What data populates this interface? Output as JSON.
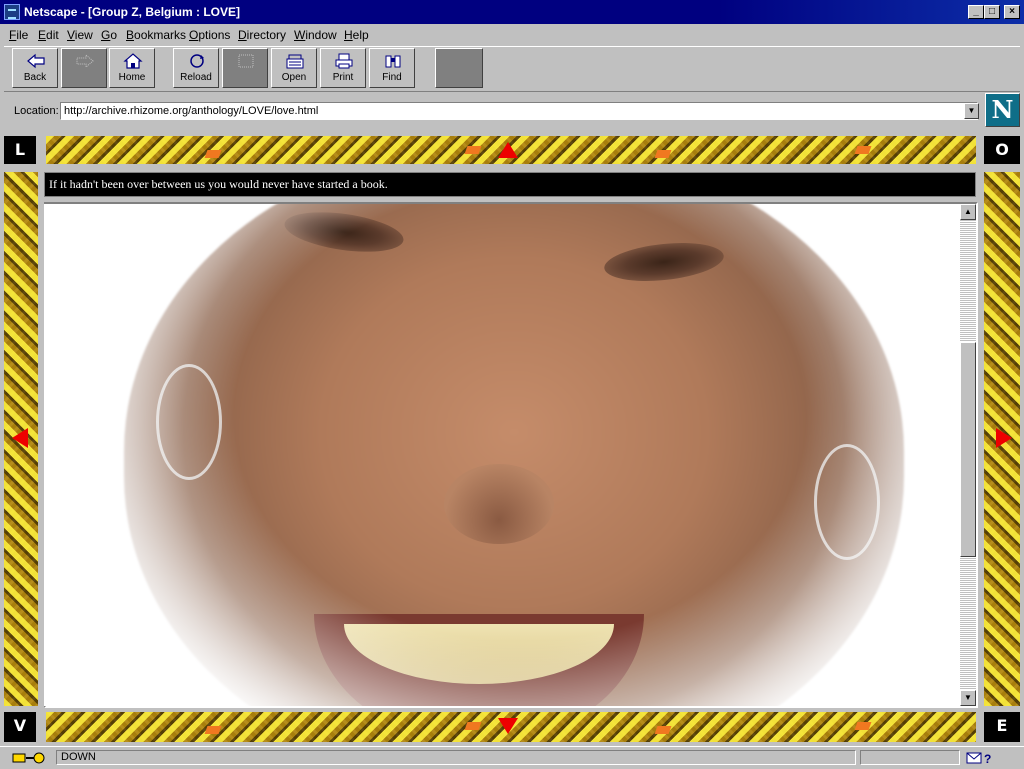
{
  "window": {
    "title": "Netscape - [Group Z, Belgium : LOVE]",
    "minimize": "_",
    "maximize": "□",
    "close": "×"
  },
  "menu": [
    "File",
    "Edit",
    "View",
    "Go",
    "Bookmarks",
    "Options",
    "Directory",
    "Window",
    "Help"
  ],
  "toolbar": {
    "back": "Back",
    "home": "Home",
    "reload": "Reload",
    "open": "Open",
    "print": "Print",
    "find": "Find"
  },
  "location": {
    "label": "Location:",
    "url": "http://archive.rhizome.org/anthology/LOVE/love.html"
  },
  "logo": "N",
  "nav_letters": {
    "top_left": "L",
    "top_right": "O",
    "bottom_left": "V",
    "bottom_right": "E"
  },
  "caption": "If it hadn't been over between us you would never have started a book.",
  "status": {
    "text": "DOWN"
  },
  "colors": {
    "titlebar": "#000080",
    "arrow": "#e00000",
    "gold": "#d8b420",
    "accent_orange": "#f07820"
  }
}
